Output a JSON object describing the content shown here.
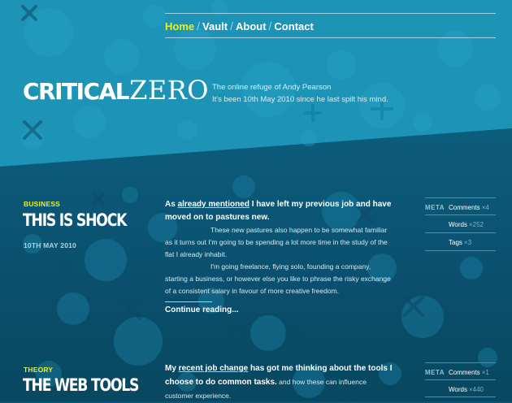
{
  "nav": {
    "items": [
      {
        "label": "Home",
        "active": true
      },
      {
        "label": "Vault",
        "active": false
      },
      {
        "label": "About",
        "active": false
      },
      {
        "label": "Contact",
        "active": false
      }
    ],
    "separator": "/"
  },
  "site": {
    "logo_bold": "CRITICAL",
    "logo_serif": "ZERO",
    "tagline_1": "The online refuge of Andy Pearson",
    "tagline_2": "It's been 10th May 2010 since he last spilt his mind."
  },
  "posts": [
    {
      "category": "BUSINESS",
      "title": "THIS IS SHOCK",
      "date": "10TH MAY 2010",
      "lead_prefix": "As ",
      "lead_link": "already mentioned",
      "lead_suffix": " I have left my previous job and have moved on to pastures new.",
      "para1": "These new pastures also happen to be somewhat familiar as it turns out I'm going to be spending a lot more time in the study of the flat I already inhabit.",
      "para2": "I'm going freelance, flying solo, founding a company, starting a business, or however else you like to phrase the risky exchange of a consistent salary in favour of more creative freedom.",
      "continue": "Continue reading...",
      "meta": {
        "label": "META",
        "rows": [
          {
            "label": "Comments",
            "count": "×4"
          },
          {
            "label": "Words",
            "count": "×252"
          },
          {
            "label": "Tags",
            "count": "×3"
          }
        ]
      }
    },
    {
      "category": "THEORY",
      "title": "THE WEB TOOLS",
      "lead_prefix": "My ",
      "lead_link": "recent job change",
      "lead_suffix": " has got me thinking about the tools I choose to do common tasks.",
      "lead_small": " and how these can influence customer experience.",
      "meta": {
        "label": "META",
        "rows": [
          {
            "label": "Comments",
            "count": "×1"
          },
          {
            "label": "Words",
            "count": "×440"
          }
        ]
      }
    }
  ],
  "colors": {
    "accent": "#e6f02b",
    "top_bg": "#1d93b6",
    "bottom_bg": "#0a5473"
  }
}
